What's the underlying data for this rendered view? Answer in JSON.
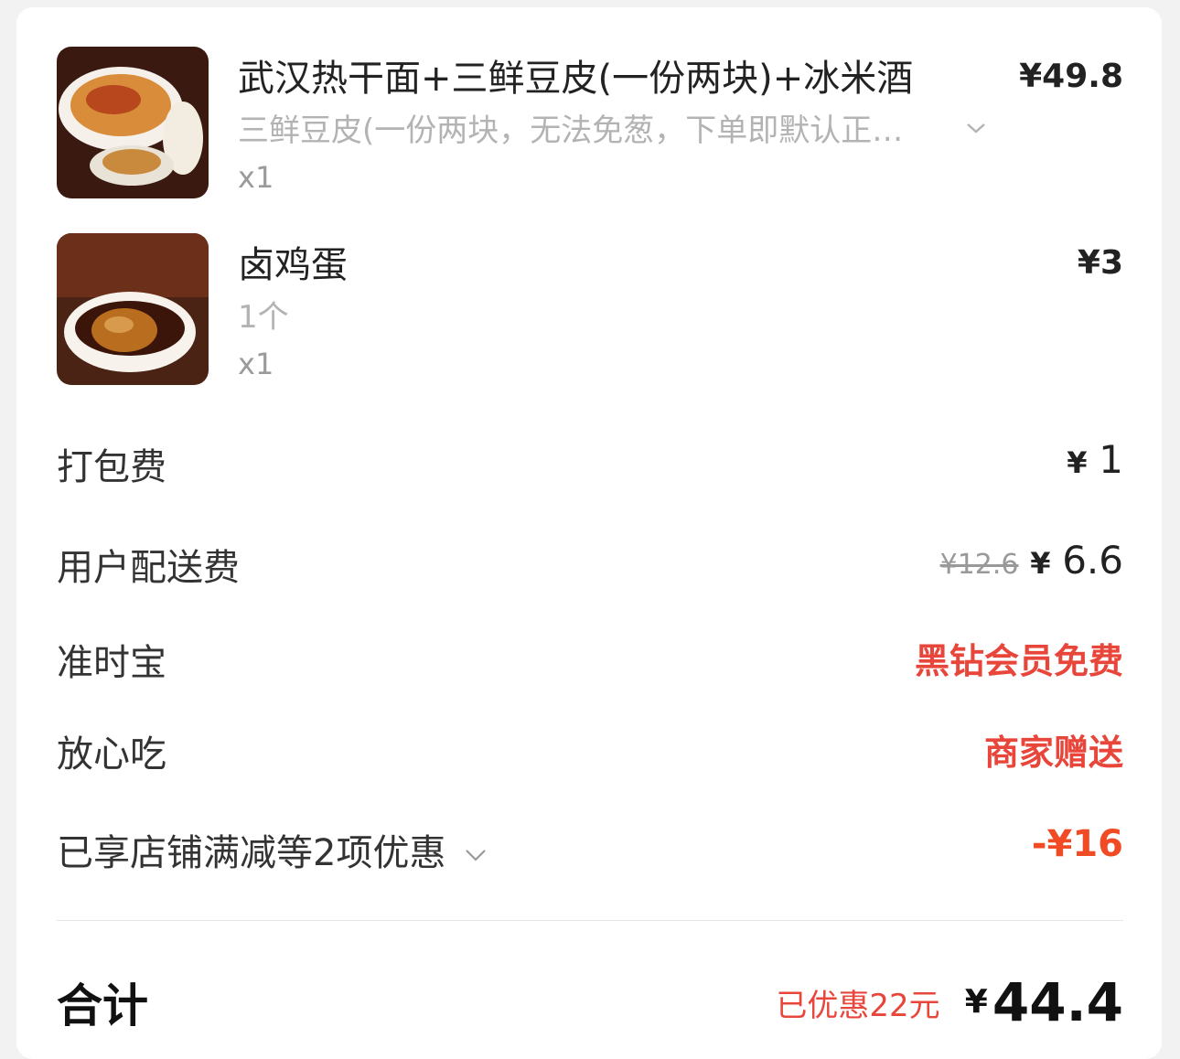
{
  "items": [
    {
      "name": "武汉热干面+三鲜豆皮(一份两块)+冰米酒",
      "spec": "三鲜豆皮(一份两块，无法免葱，下单即默认正…",
      "qty": "x1",
      "price": "¥49.8",
      "image": "hot-dry-noodles-combo"
    },
    {
      "name": "卤鸡蛋",
      "spec": "1个",
      "qty": "x1",
      "price": "¥3",
      "image": "braised-egg"
    }
  ],
  "fees": {
    "packing": {
      "label": "打包费",
      "yen": "¥",
      "value": "1"
    },
    "delivery": {
      "label": "用户配送费",
      "original": "¥12.6",
      "yen": "¥",
      "value": "6.6"
    },
    "ontime": {
      "label": "准时宝",
      "value": "黑钻会员免费"
    },
    "safe_eat": {
      "label": "放心吃",
      "value": "商家赠送"
    },
    "discount": {
      "label": "已享店铺满减等2项优惠",
      "value": "-¥16"
    }
  },
  "total": {
    "label": "合计",
    "saved": "已优惠22元",
    "yen": "¥",
    "value": "44.4"
  },
  "colors": {
    "accent_red": "#e8463b",
    "accent_orange": "#f04b24",
    "muted_text": "#b3b3b3"
  }
}
